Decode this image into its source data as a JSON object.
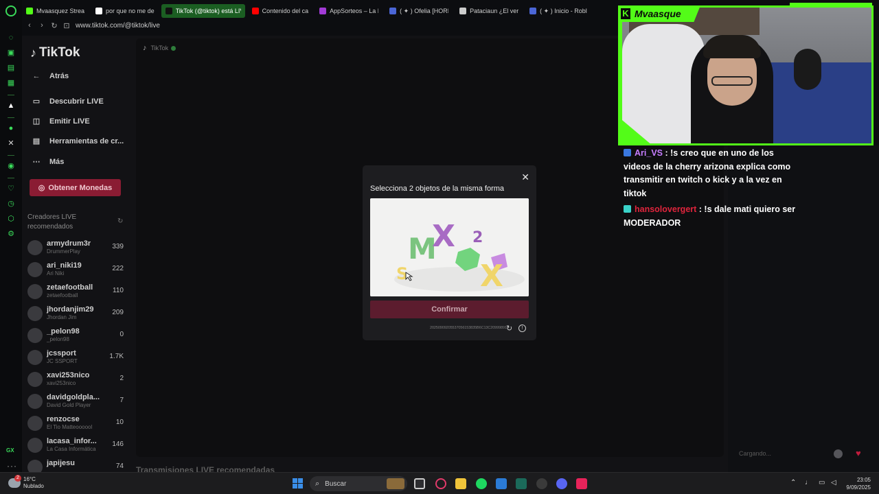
{
  "browser": {
    "tabs": [
      {
        "title": "Mvaasquez Strea",
        "color": "#53fc18",
        "active": false
      },
      {
        "title": "por que no me de",
        "color": "#ffffff",
        "active": false
      },
      {
        "title": "TikTok (@tiktok) está LIVE",
        "color": "#111111",
        "active": true
      },
      {
        "title": "Contenido del ca",
        "color": "#ff0000",
        "active": false
      },
      {
        "title": "AppSorteos – La P",
        "color": "#a23bd6",
        "active": false
      },
      {
        "title": "( ✦ ) Ofelia [HORR",
        "color": "#4b66d6",
        "active": false
      },
      {
        "title": "Pataciaun ¿El ver",
        "color": "#cccccc",
        "active": false
      },
      {
        "title": "( ✦ ) Inicio - Robl",
        "color": "#4b66d6",
        "active": false
      }
    ],
    "url": "www.tiktok.com/@tiktok/live",
    "gx_label": "GX"
  },
  "tiktok": {
    "logo": "TikTok",
    "menu": [
      {
        "label": "Atrás",
        "icon": "arrow-left-icon",
        "glyph": "←"
      },
      {
        "label": "Descubrir LIVE",
        "icon": "tv-icon",
        "glyph": "▭"
      },
      {
        "label": "Emitir LIVE",
        "icon": "camera-icon",
        "glyph": "◫"
      },
      {
        "label": "Herramientas de cr...",
        "icon": "tools-icon",
        "glyph": "▤"
      },
      {
        "label": "Más",
        "icon": "more-icon",
        "glyph": "⋯"
      }
    ],
    "coins_button": "Obtener Monedas",
    "recommended_header": "Creadores LIVE recomendados",
    "creators": [
      {
        "name": "armydrum3r",
        "sub": "DrummerPlay",
        "count": "339"
      },
      {
        "name": "ari_niki19",
        "sub": "Ari Niki",
        "count": "222"
      },
      {
        "name": "zetaefootball",
        "sub": "zetaefootball",
        "count": "110"
      },
      {
        "name": "jhordanjim29",
        "sub": "Jhordan Jim",
        "count": "209"
      },
      {
        "name": "_pelon98",
        "sub": "_pelon98",
        "count": "0"
      },
      {
        "name": "jcssport",
        "sub": "JC SSPORT",
        "count": "1.7K"
      },
      {
        "name": "xavi253nico",
        "sub": "xavi253nico",
        "count": "2"
      },
      {
        "name": "davidgoldpla...",
        "sub": "David Gold Player",
        "count": "7"
      },
      {
        "name": "renzocse",
        "sub": "El Tio Matteoooool",
        "count": "10"
      },
      {
        "name": "lacasa_infor...",
        "sub": "La Casa Informática",
        "count": "146"
      },
      {
        "name": "japijesu",
        "sub": "",
        "count": "74"
      }
    ],
    "main_tag": "TikTok",
    "recommended_live": "Transmisiones LIVE recomendadas"
  },
  "captcha": {
    "title": "Selecciona 2 objetos de la misma forma",
    "confirm": "Confirmar",
    "id": "20250909205537056153835B6C13C20999891",
    "letters": [
      "M",
      "X",
      "2",
      "X",
      "S"
    ]
  },
  "stream": {
    "streamer": "Mvaasque",
    "accent": "#53fc18",
    "chat": [
      {
        "user": "Ari_VS",
        "user_color": "#c67dff",
        "badge_color": "#3a78e0",
        "text": " : !s creo que en uno de los videos de la cherry arizona explica como transmitir en twitch o kick y a la vez en tiktok"
      },
      {
        "user": "hansolovergert",
        "user_color": "#e0243c",
        "badge_color": "#3ad2c8",
        "text": " : !s dale mati quiero ser MODERADOR"
      }
    ],
    "chat_placeholder": "Cargando..."
  },
  "taskbar": {
    "weather_temp": "16°C",
    "weather_desc": "Nublado",
    "weather_badge": "2",
    "search": "Buscar",
    "time": "23:05",
    "date": "9/09/2025"
  }
}
